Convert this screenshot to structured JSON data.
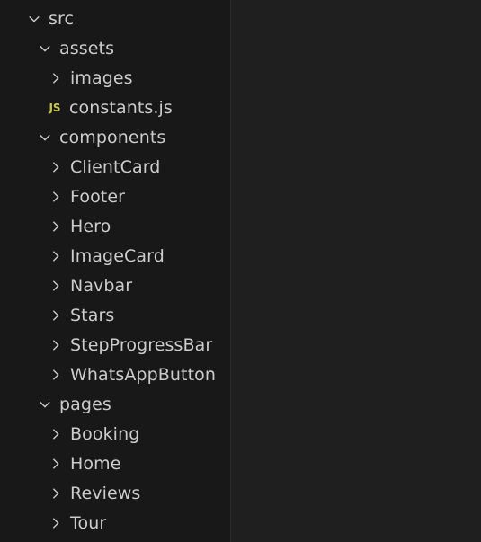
{
  "explorer": {
    "tree": {
      "src": "src",
      "assets": "assets",
      "images": "images",
      "constants_js": "constants.js",
      "js_badge": "JS",
      "components": "components",
      "component_items": [
        "ClientCard",
        "Footer",
        "Hero",
        "ImageCard",
        "Navbar",
        "Stars",
        "StepProgressBar",
        "WhatsAppButton"
      ],
      "pages": "pages",
      "page_items": [
        "Booking",
        "Home",
        "Reviews",
        "Tour"
      ]
    }
  },
  "colors": {
    "sidebar_bg": "#181818",
    "editor_bg": "#1f1f1f",
    "text": "#cccccc",
    "js_icon": "#cbcb41"
  },
  "icons": {
    "expanded": "chevron-down-icon",
    "collapsed": "chevron-right-icon",
    "js_file": "javascript-file-icon"
  }
}
